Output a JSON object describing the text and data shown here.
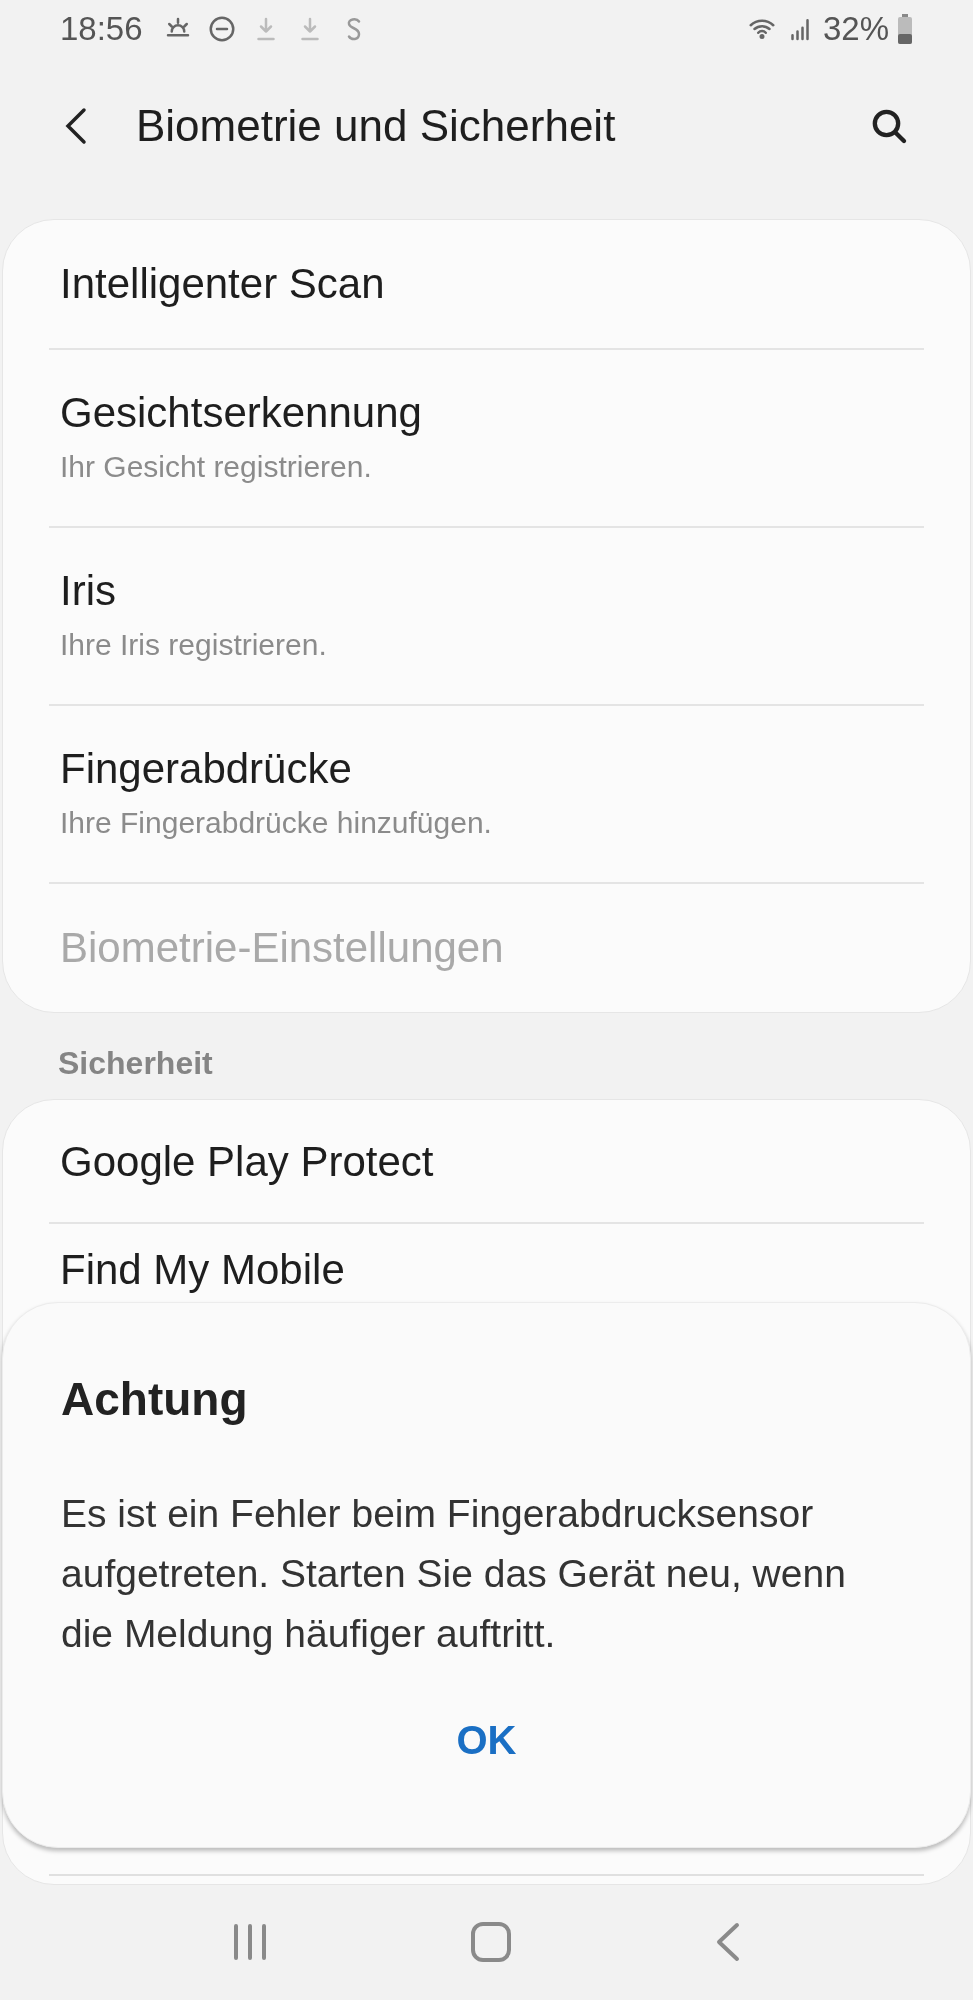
{
  "status_bar": {
    "time": "18:56",
    "battery": "32%"
  },
  "header": {
    "title": "Biometrie und Sicherheit"
  },
  "biometrics": [
    {
      "title": "Intelligenter Scan",
      "disabled": false
    },
    {
      "title": "Gesichtserkennung",
      "subtitle": "Ihr Gesicht registrieren.",
      "disabled": false
    },
    {
      "title": "Iris",
      "subtitle": "Ihre Iris registrieren.",
      "disabled": false
    },
    {
      "title": "Fingerabdrücke",
      "subtitle": "Ihre Fingerabdrücke hinzufügen.",
      "disabled": false
    },
    {
      "title": "Biometrie-Einstellungen",
      "disabled": true
    }
  ],
  "security": {
    "heading": "Sicherheit",
    "items": [
      {
        "title": "Google Play Protect"
      },
      {
        "title": "Find My Mobile"
      }
    ]
  },
  "dialog": {
    "title": "Achtung",
    "message": "Es ist ein Fehler beim Fingerabdrucksensor aufgetreten. Starten Sie das Gerät neu, wenn die Meldung häufiger auftritt.",
    "button": "OK"
  }
}
